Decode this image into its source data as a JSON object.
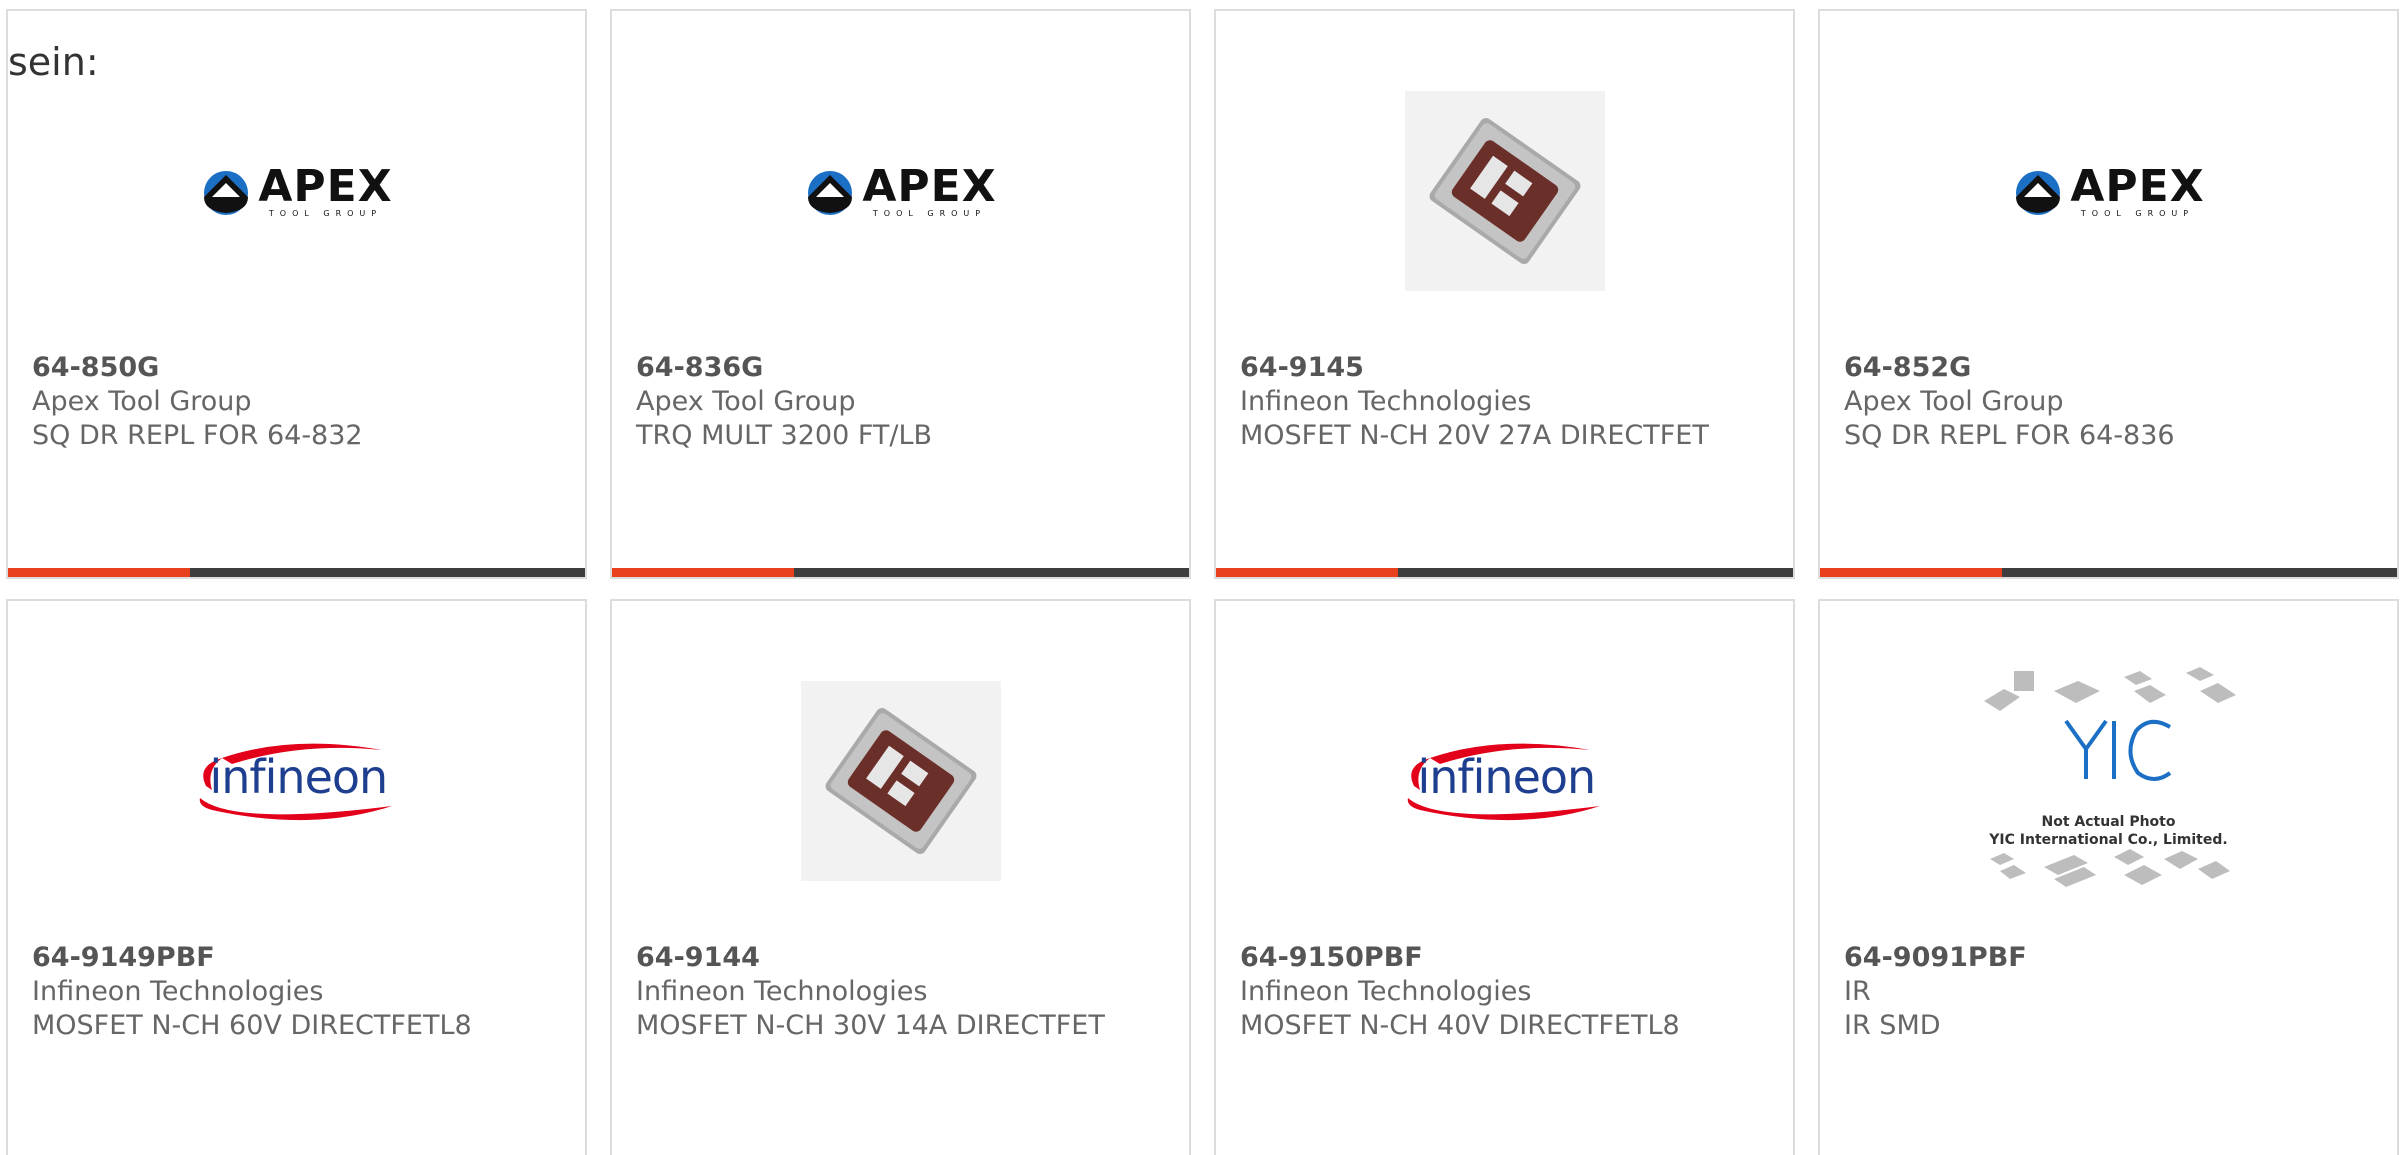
{
  "intro_text": "sein:",
  "accent_color": "#e8401c",
  "bar_color": "#3d3d3d",
  "products": [
    {
      "part_number": "64-850G",
      "manufacturer": "Apex Tool Group",
      "description": "SQ DR REPL FOR 64-832",
      "image": "apex-tool-group-logo",
      "logo_word": "APEX",
      "logo_sub": "TOOL GROUP"
    },
    {
      "part_number": "64-836G",
      "manufacturer": "Apex Tool Group",
      "description": "TRQ MULT 3200 FT/LB",
      "image": "apex-tool-group-logo",
      "logo_word": "APEX",
      "logo_sub": "TOOL GROUP"
    },
    {
      "part_number": "64-9145",
      "manufacturer": "Infineon Technologies",
      "description": "MOSFET N-CH 20V 27A DIRECTFET",
      "image": "directfet-package-photo"
    },
    {
      "part_number": "64-852G",
      "manufacturer": "Apex Tool Group",
      "description": "SQ DR REPL FOR 64-836",
      "image": "apex-tool-group-logo",
      "logo_word": "APEX",
      "logo_sub": "TOOL GROUP"
    },
    {
      "part_number": "64-9149PBF",
      "manufacturer": "Infineon Technologies",
      "description": "MOSFET N-CH 60V DIRECTFETL8",
      "image": "infineon-logo",
      "logo_word": "infineon"
    },
    {
      "part_number": "64-9144",
      "manufacturer": "Infineon Technologies",
      "description": "MOSFET N-CH 30V 14A DIRECTFET",
      "image": "directfet-package-photo"
    },
    {
      "part_number": "64-9150PBF",
      "manufacturer": "Infineon Technologies",
      "description": "MOSFET N-CH 40V DIRECTFETL8",
      "image": "infineon-logo",
      "logo_word": "infineon"
    },
    {
      "part_number": "64-9091PBF",
      "manufacturer": "IR",
      "description": "IR SMD",
      "image": "yic-placeholder-image",
      "caption_line1": "Not Actual Photo",
      "caption_line2": "YIC International Co., Limited."
    }
  ]
}
